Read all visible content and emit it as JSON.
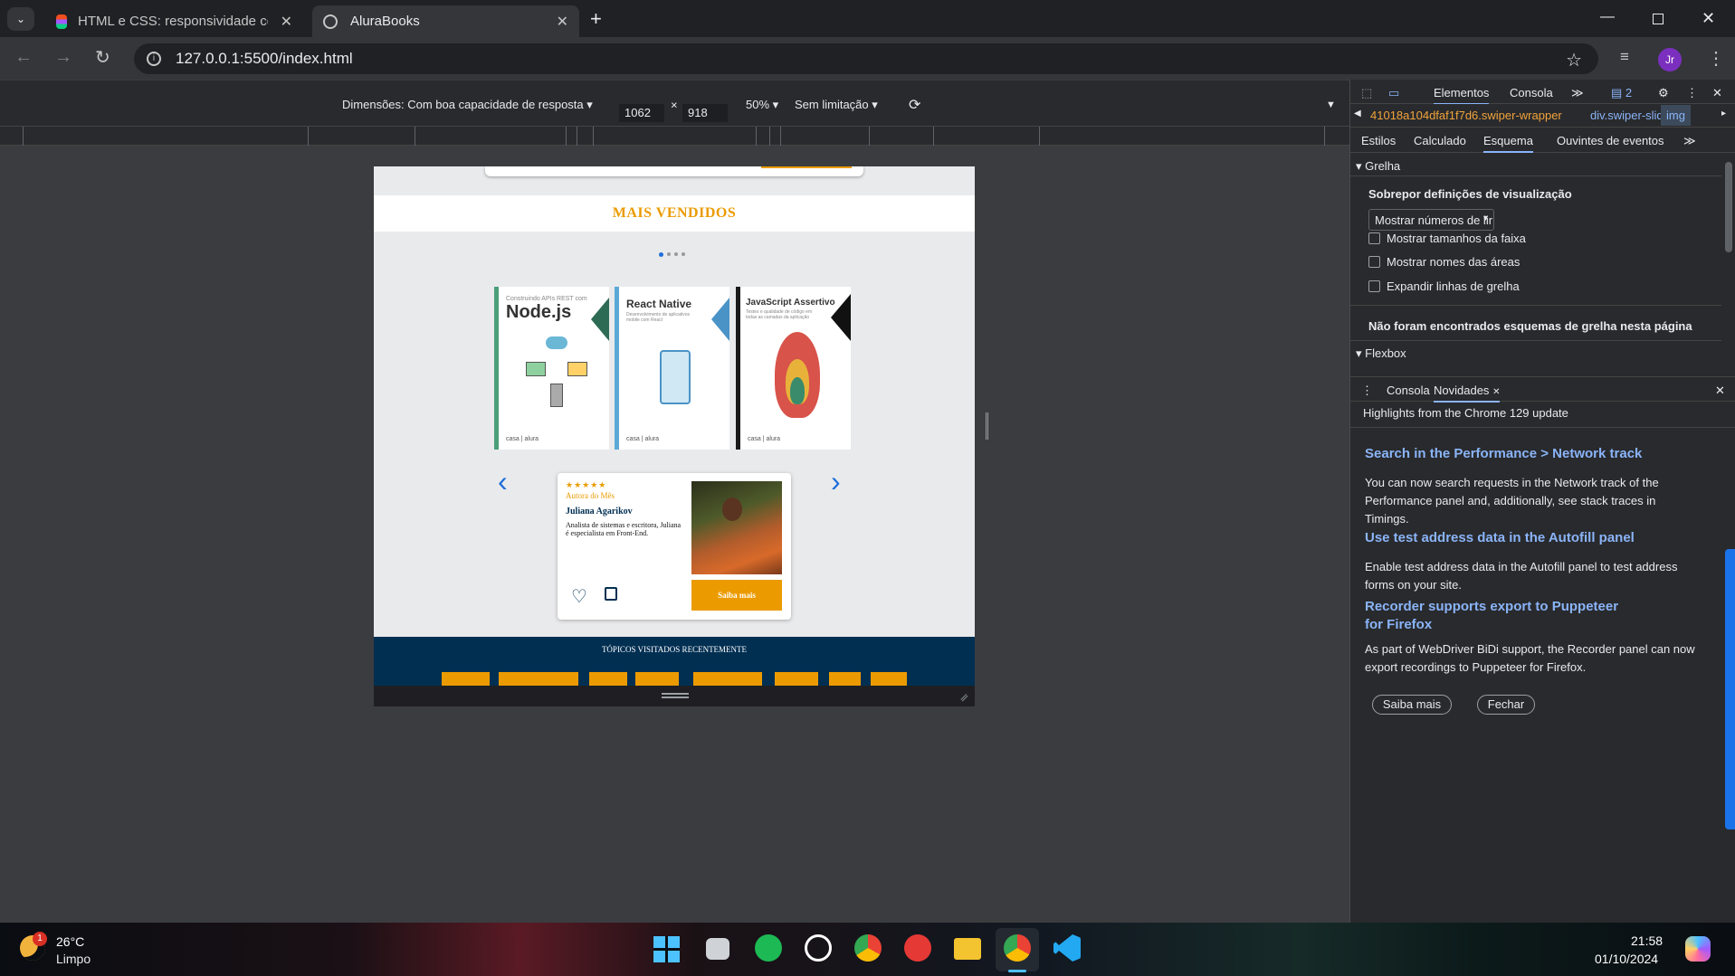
{
  "browser": {
    "tabs": [
      {
        "title": "HTML e CSS: responsividade co",
        "active": false
      },
      {
        "title": "AluraBooks",
        "active": true
      }
    ],
    "url": "127.0.0.1:5500/index.html",
    "profile_initials": "Jr"
  },
  "device_toolbar": {
    "dimensions_label": "Dimensões: Com boa capacidade de resposta",
    "width": "1062",
    "height": "918",
    "zoom": "50%",
    "throttle": "Sem limitação"
  },
  "site": {
    "section_title": "MAIS VENDIDOS",
    "books": [
      {
        "title": "Node.js",
        "subtitle": "Construindo APIs REST com",
        "accent": "#4a9e78"
      },
      {
        "title": "React Native",
        "subtitle": "Desenvolvimento de aplicativos mobile com React",
        "accent": "#5aa9d6"
      },
      {
        "title": "JavaScript Assertivo",
        "subtitle": "Testes e qualidade de código em todas as camadas da aplicação",
        "accent": "#1a1a1a"
      }
    ],
    "author_card": {
      "stars": "★★★★★",
      "badge": "Autora do Mês",
      "name": "Juliana Agarikov",
      "bio": "Analista de sistemas e escritora, Juliana é especialista em Front-End.",
      "cta": "Saiba mais"
    },
    "footer_title": "TÓPICOS VISITADOS RECENTEMENTE",
    "accent_color": "#eb9b00",
    "footer_color": "#002f52"
  },
  "devtools": {
    "top_tabs": [
      "Elementos",
      "Consola"
    ],
    "issues_count": "2",
    "breadcrumb": [
      "41018a104dfaf1f7d6.swiper-wrapper",
      "div.swiper-slide",
      "img"
    ],
    "sub_tabs": [
      "Estilos",
      "Calculado",
      "Esquema",
      "Ouvintes de eventos"
    ],
    "grid_section": "Grelha",
    "overlay_heading": "Sobrepor definições de visualização",
    "dropdown_value": "Mostrar números de lir",
    "checkboxes": [
      "Mostrar tamanhos da faixa",
      "Mostrar nomes das áreas",
      "Expandir linhas de grelha"
    ],
    "no_grid_msg": "Não foram encontrados esquemas de grelha nesta página",
    "flexbox_section": "Flexbox",
    "drawer_tabs": [
      "Consola",
      "Novidades"
    ],
    "highlights_title": "Highlights from the Chrome 129 update",
    "whats_new": [
      {
        "heading": "Search in the Performance > Network track",
        "body": "You can now search requests in the Network track of the Performance panel and, additionally, see stack traces in Timings."
      },
      {
        "heading": "Use test address data in the Autofill panel",
        "body": "Enable test address data in the Autofill panel to test address forms on your site."
      },
      {
        "heading": "Recorder supports export to Puppeteer for Firefox",
        "body": "As part of WebDriver BiDi support, the Recorder panel can now export recordings to Puppeteer for Firefox."
      }
    ],
    "learn_more": "Saiba mais",
    "close": "Fechar"
  },
  "taskbar": {
    "temperature": "26°C",
    "weather": "Limpo",
    "weather_badge": "1",
    "time": "21:58",
    "date": "01/10/2024"
  }
}
